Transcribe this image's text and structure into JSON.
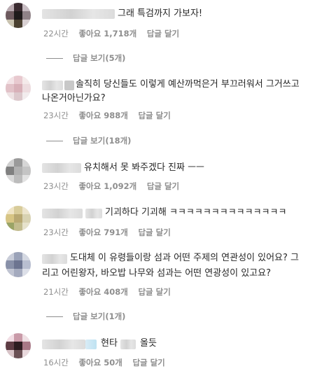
{
  "comments": [
    {
      "text": "그래 특검까지 가보자!",
      "time": "22시간",
      "likes": "좋아요 1,718개",
      "reply": "답글 달기",
      "view_replies": "답글 보기(5개)"
    },
    {
      "text_line1": "솔직히 당신들도 이렇게 예산까먹은거 부끄러워서 그거쓰고",
      "text_line2": "나온거아닌가요?",
      "time": "23시간",
      "likes": "좋아요 988개",
      "reply": "답글 달기",
      "view_replies": "답글 보기(18개)"
    },
    {
      "text": "유치해서 못 봐주겠다 진짜 ㅡㅡ",
      "time": "23시간",
      "likes": "좋아요 1,092개",
      "reply": "답글 달기"
    },
    {
      "text": "기괴하다 기괴해 ㅋㅋㅋㅋㅋㅋㅋㅋㅋㅋㅋㅋㅋㅋ",
      "time": "23시간",
      "likes": "좋아요 791개",
      "reply": "답글 달기"
    },
    {
      "text_line1": "도대체 이 유령들이랑 섬과 어떤 주제의 연관성이 있어요? 그",
      "text_line2": "리고 어린왕자, 바오밥 나무와 섬과는 어떤 연광성이 있고요?",
      "time": "21시간",
      "likes": "좋아요 408개",
      "reply": "답글 달기",
      "view_replies": "답글 보기(1개)"
    },
    {
      "text_a": "현타",
      "text_b": "올듯",
      "time": "16시간",
      "likes": "좋아요 50개",
      "reply": "답글 달기"
    }
  ]
}
